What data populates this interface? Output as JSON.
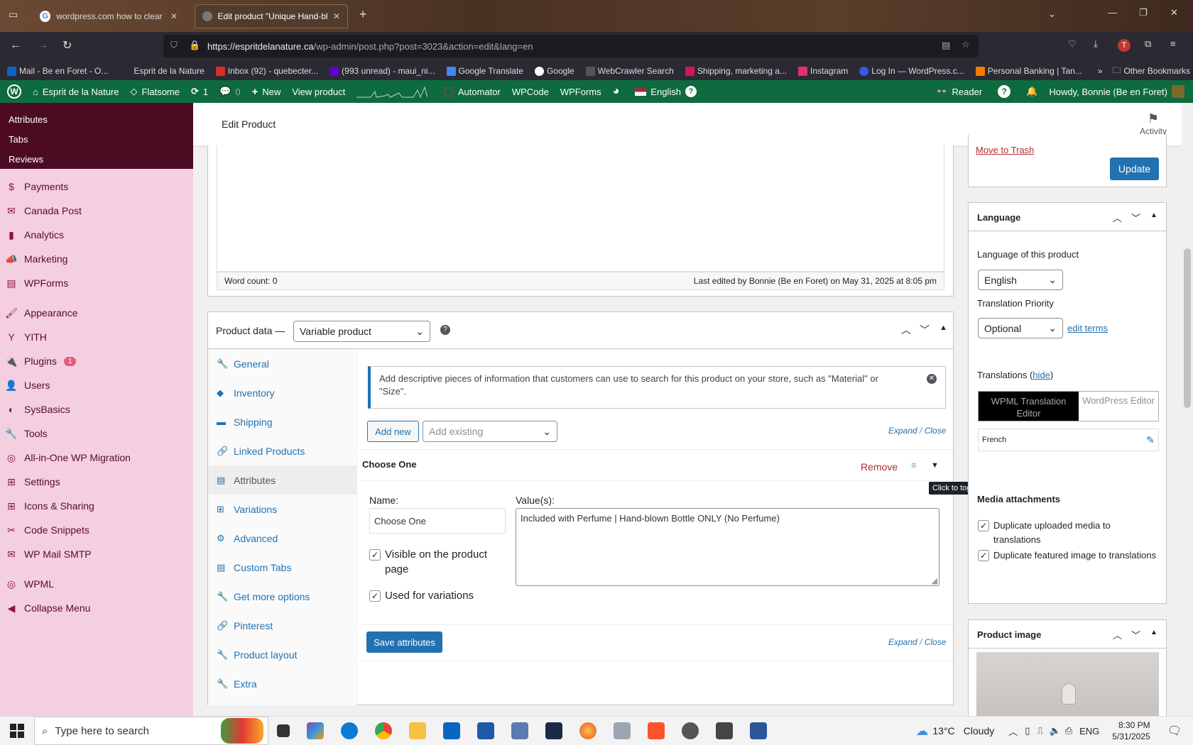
{
  "browser": {
    "tabs": [
      {
        "title": "wordpress.com how to clear gl"
      },
      {
        "title": "Edit product \"Unique Hand-blo"
      }
    ],
    "url_domain": "https://espritdelanature.ca",
    "url_path": "/wp-admin/post.php?post=3023&action=edit&lang=en",
    "bookmarks": [
      "Mail - Be en Foret - O...",
      "Esprit de la Nature",
      "Inbox (92) - quebecter...",
      "(993 unread) - maui_ni...",
      "Google Translate",
      "Google",
      "WebCrawler Search",
      "Shipping, marketing a...",
      "Instagram",
      "Log In — WordPress.c...",
      "Personal Banking | Tan..."
    ],
    "other_bookmarks": "Other Bookmarks"
  },
  "adminbar": {
    "site": "Esprit de la Nature",
    "theme": "Flatsome",
    "updates": "1",
    "comments": "0",
    "new": "New",
    "view": "View product",
    "automator": "Automator",
    "wpcode": "WPCode",
    "wpforms": "WPForms",
    "language": "English",
    "reader": "Reader",
    "howdy": "Howdy, Bonnie (Be en Foret)"
  },
  "sidebar": {
    "submenu": [
      "Attributes",
      "Tabs",
      "Reviews"
    ],
    "items": [
      {
        "label": "Payments",
        "icon": "$"
      },
      {
        "label": "Canada Post",
        "icon": "✉"
      },
      {
        "label": "Analytics",
        "icon": "▮"
      },
      {
        "label": "Marketing",
        "icon": "📣"
      },
      {
        "label": "WPForms",
        "icon": "▤"
      },
      {
        "label": "Appearance",
        "icon": "🖌"
      },
      {
        "label": "YITH",
        "icon": "Y"
      },
      {
        "label": "Plugins",
        "icon": "🔌",
        "badge": "1"
      },
      {
        "label": "Users",
        "icon": "👤"
      },
      {
        "label": "SysBasics",
        "icon": "◐"
      },
      {
        "label": "Tools",
        "icon": "🔧"
      },
      {
        "label": "All-in-One WP Migration",
        "icon": "◎"
      },
      {
        "label": "Settings",
        "icon": "⊞"
      },
      {
        "label": "Icons & Sharing",
        "icon": "⊞"
      },
      {
        "label": "Code Snippets",
        "icon": "✂"
      },
      {
        "label": "WP Mail SMTP",
        "icon": "✉"
      },
      {
        "label": "WPML",
        "icon": "◎"
      },
      {
        "label": "Collapse Menu",
        "icon": "◀"
      }
    ]
  },
  "header": {
    "title": "Edit Product",
    "activity": "Activity"
  },
  "editor": {
    "word_count": "Word count: 0",
    "last_edited": "Last edited by Bonnie (Be en Foret) on May 31, 2025 at 8:05 pm"
  },
  "product_data": {
    "label": "Product data —",
    "type": "Variable product",
    "tabs": [
      "General",
      "Inventory",
      "Shipping",
      "Linked Products",
      "Attributes",
      "Variations",
      "Advanced",
      "Custom Tabs",
      "Get more options",
      "Pinterest",
      "Product layout",
      "Extra"
    ],
    "notice": "Add descriptive pieces of information that customers can use to search for this product on your store, such as \"Material\" or \"Size\".",
    "add_new": "Add new",
    "add_existing": "Add existing",
    "expand": "Expand",
    "close": "Close",
    "attribute_title": "Choose One",
    "remove": "Remove",
    "tooltip": "Click to toggle",
    "name_label": "Name:",
    "name_value": "Choose One",
    "values_label": "Value(s):",
    "values_value": "Included with Perfume | Hand-blown Bottle ONLY (No Perfume)",
    "visible_label": "Visible on the product page",
    "variations_label": "Used for variations",
    "save": "Save attributes"
  },
  "publish": {
    "trash": "Move to Trash",
    "update": "Update"
  },
  "language": {
    "title": "Language",
    "lang_label": "Language of this product",
    "lang_value": "English",
    "priority_label": "Translation Priority",
    "priority_value": "Optional",
    "edit_terms": "edit terms",
    "translations_label": "Translations",
    "hide": "hide",
    "wpml_editor": "WPML Translation Editor",
    "wp_editor": "WordPress Editor",
    "french": "French",
    "media_title": "Media attachments",
    "dup_media": "Duplicate uploaded media to translations",
    "dup_featured": "Duplicate featured image to translations"
  },
  "product_image": {
    "title": "Product image"
  },
  "taskbar": {
    "search": "Type here to search",
    "weather_temp": "13°C",
    "weather_desc": "Cloudy",
    "lang": "ENG",
    "time": "8:30 PM",
    "date": "5/31/2025"
  }
}
